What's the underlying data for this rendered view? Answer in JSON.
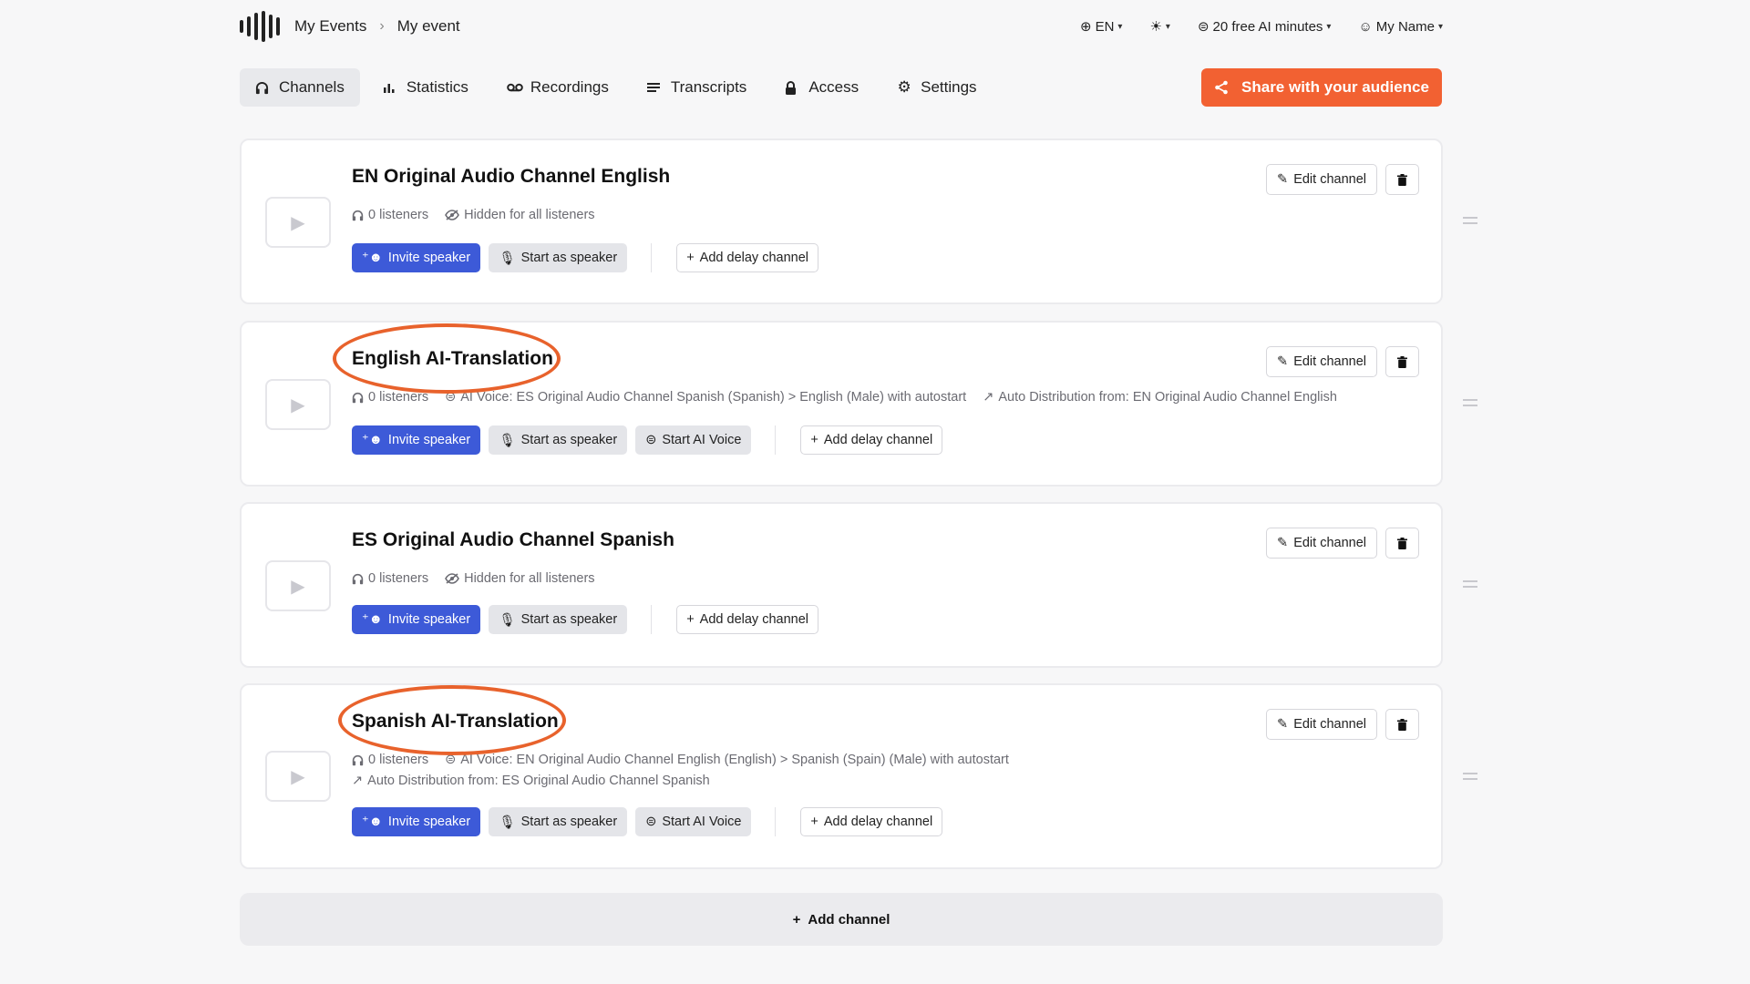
{
  "breadcrumb": {
    "home": "My Events",
    "current": "My event"
  },
  "top_right": {
    "language": "EN",
    "ai_minutes": "20 free AI minutes",
    "user": "My Name"
  },
  "tabs": [
    {
      "label": "Channels",
      "icon": "headphones-icon",
      "active": true
    },
    {
      "label": "Statistics",
      "icon": "bar-chart-icon"
    },
    {
      "label": "Recordings",
      "icon": "recording-icon"
    },
    {
      "label": "Transcripts",
      "icon": "lines-icon"
    },
    {
      "label": "Access",
      "icon": "lock-icon"
    },
    {
      "label": "Settings",
      "icon": "gear-icon"
    }
  ],
  "share_button": "Share with your audience",
  "common": {
    "edit_channel": "Edit channel",
    "invite_speaker": "Invite speaker",
    "start_as_speaker": "Start as speaker",
    "start_ai_voice": "Start AI Voice",
    "add_delay_channel": "Add delay channel",
    "listeners": "0 listeners",
    "hidden": "Hidden for all listeners"
  },
  "channels": [
    {
      "title": "EN Original Audio Channel English"
    },
    {
      "title": "English AI-Translation",
      "ai_voice": "AI Voice: ES Original Audio Channel Spanish (Spanish) > English (Male) with autostart",
      "auto_distribution": "Auto Distribution from: EN Original Audio Channel English"
    },
    {
      "title": "ES Original Audio Channel Spanish"
    },
    {
      "title": "Spanish AI-Translation",
      "ai_voice": "AI Voice: EN Original Audio Channel English (English) > Spanish (Spain) (Male) with autostart",
      "auto_distribution": "Auto Distribution from: ES Original Audio Channel Spanish"
    }
  ],
  "add_channel": "Add channel",
  "colors": {
    "accent": "#f26132",
    "primary": "#3d5ad8",
    "highlight": "#e8622c"
  }
}
